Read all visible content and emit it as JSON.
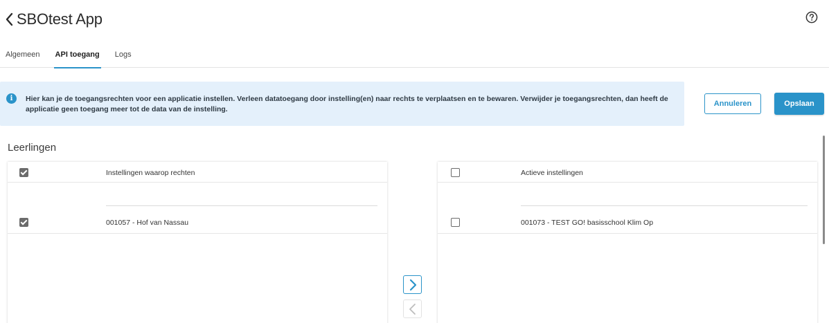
{
  "header": {
    "title": "SBOtest App",
    "back_icon": "chevron-left-icon",
    "help_icon": "help-circle-icon"
  },
  "tabs": [
    {
      "label": "Algemeen",
      "active": false
    },
    {
      "label": "API toegang",
      "active": true
    },
    {
      "label": "Logs",
      "active": false
    }
  ],
  "info": {
    "icon": "info-icon",
    "text": "Hier kan je de toegangsrechten voor een applicatie instellen. Verleen datatoegang door instelling(en) naar rechts te verplaatsen en te bewaren. Verwijder je toegangsrechten, dan heeft de applicatie geen toegang meer tot de data van de instelling."
  },
  "actions": {
    "cancel_label": "Annuleren",
    "save_label": "Opslaan"
  },
  "section": {
    "title": "Leerlingen"
  },
  "left_panel": {
    "header": "Instellingen waarop rechten",
    "header_checked": true,
    "rows": [
      {
        "label": "001057 - Hof van Nassau",
        "checked": true
      }
    ]
  },
  "right_panel": {
    "header": "Actieve instellingen",
    "header_checked": false,
    "rows": [
      {
        "label": "001073 - TEST GO! basisschool Klim Op",
        "checked": false
      }
    ]
  },
  "transfer": {
    "move_right_icon": "chevron-right-icon",
    "move_left_icon": "chevron-left-icon"
  },
  "colors": {
    "accent": "#2a93c9",
    "info_background": "#e4f0fb",
    "checkbox": "#6b6b6b"
  }
}
